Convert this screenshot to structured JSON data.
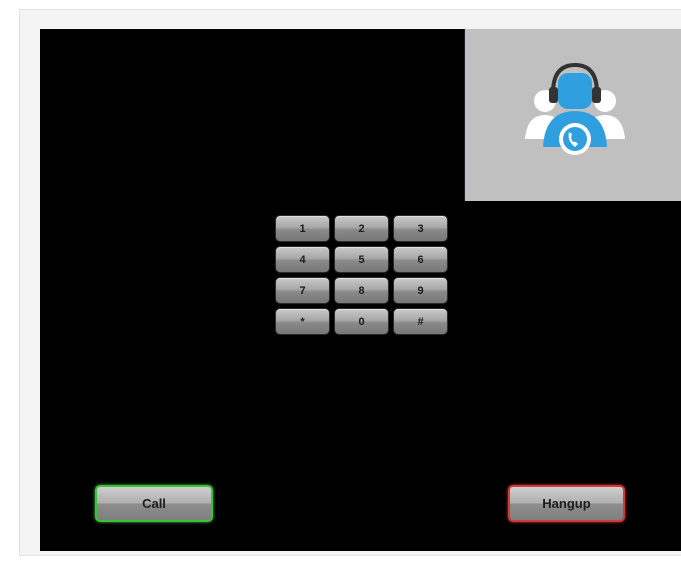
{
  "dialpad": {
    "keys": [
      "1",
      "2",
      "3",
      "4",
      "5",
      "6",
      "7",
      "8",
      "9",
      "*",
      "0",
      "#"
    ]
  },
  "actions": {
    "call_label": "Call",
    "hangup_label": "Hangup"
  },
  "colors": {
    "call_border": "#3bc23b",
    "hangup_border": "#cf3a3a",
    "avatar_blue": "#2f9fe0",
    "preview_bg": "#c0c0c0"
  },
  "icons": {
    "preview_avatar": "call-center-agent-icon"
  }
}
